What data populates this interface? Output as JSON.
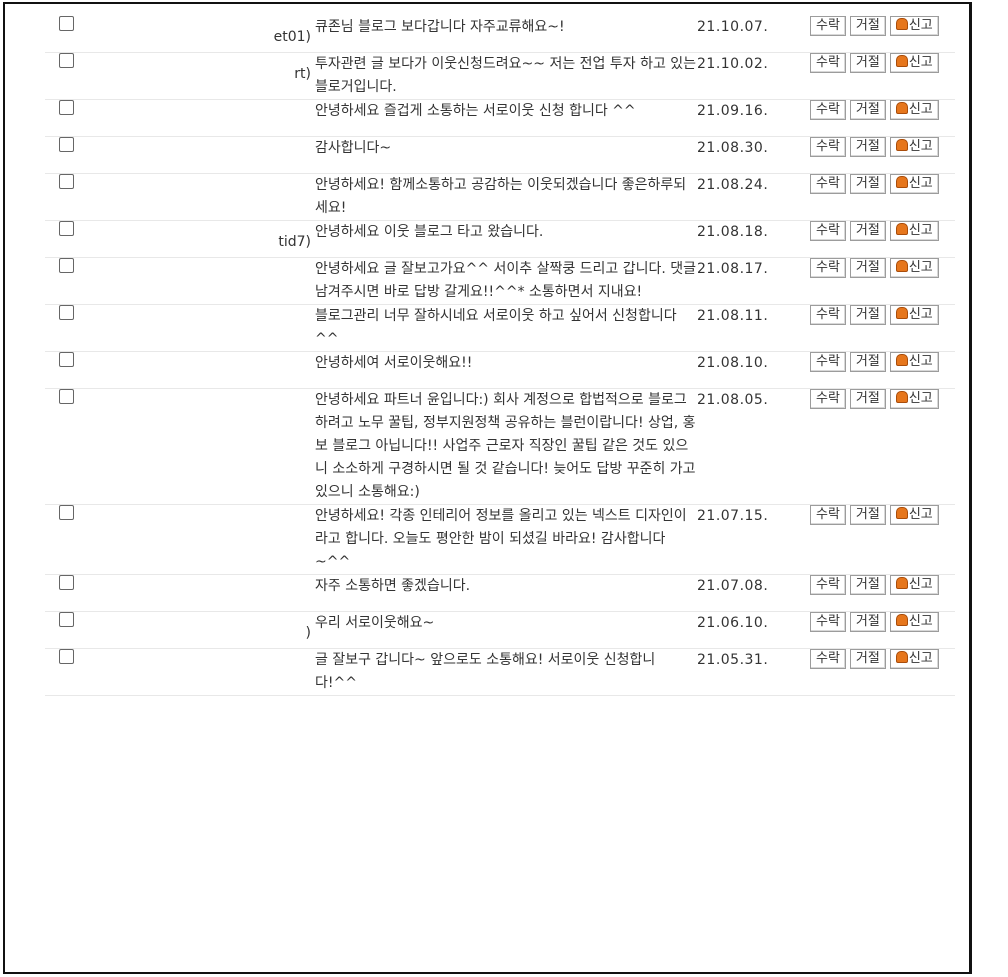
{
  "buttons": {
    "accept": "수락",
    "reject": "거절",
    "report": "신고"
  },
  "requests": [
    {
      "name_lead": "",
      "name_tail": "et01)",
      "message": "큐존님 블로그 보다갑니다 자주교류해요~!",
      "date": "21.10.07."
    },
    {
      "name_lead": "",
      "name_tail": "rt)",
      "message": "투자관련 글 보다가 이웃신청드려요~~ 저는 전업 투자 하고 있는 블로거입니다.",
      "date": "21.10.02."
    },
    {
      "name_lead": "",
      "name_tail": "",
      "message": "안녕하세요 즐겁게 소통하는 서로이웃 신청 합니다 ^^",
      "date": "21.09.16."
    },
    {
      "name_lead": "",
      "name_tail": "",
      "message": "감사합니다~",
      "date": "21.08.30."
    },
    {
      "name_lead": "",
      "name_tail": "",
      "message": "안녕하세요! 함께소통하고 공감하는 이웃되겠습니다 좋은하루되세요!",
      "date": "21.08.24."
    },
    {
      "name_lead": "",
      "name_tail": "tid7)",
      "message": "안녕하세요 이웃 블로그 타고 왔습니다.",
      "date": "21.08.18."
    },
    {
      "name_lead": "",
      "name_tail": "",
      "message": "안녕하세요 글 잘보고가요^^ 서이추 살짝쿵 드리고 갑니다. 댓글 남겨주시면 바로 답방 갈게요!!^^* 소통하면서 지내요!",
      "date": "21.08.17."
    },
    {
      "name_lead": "",
      "name_tail": "",
      "message": "블로그관리 너무 잘하시네요 서로이웃 하고 싶어서 신청합니다^^",
      "date": "21.08.11."
    },
    {
      "name_lead": "",
      "name_tail": "",
      "message": "안녕하세여 서로이웃해요!!",
      "date": "21.08.10."
    },
    {
      "name_lead": "",
      "name_tail": "",
      "message": "안녕하세요 파트너 윤입니다:) 회사 계정으로 합법적으로 블로그 하려고 노무 꿀팁, 정부지원정책 공유하는 블런이랍니다! 상업, 홍보 블로그 아닙니다!! 사업주 근로자 직장인 꿀팁 같은 것도 있으니 소소하게 구경하시면 될 것 같습니다! 늦어도 답방 꾸준히 가고 있으니 소통해요:)",
      "date": "21.08.05."
    },
    {
      "name_lead": "",
      "name_tail": "",
      "message": "안녕하세요! 각종 인테리어 정보를 올리고 있는 넥스트 디자인이라고 합니다. 오늘도 평안한 밤이 되셨길 바라요! 감사합니다~^^",
      "date": "21.07.15."
    },
    {
      "name_lead": "",
      "name_tail": "",
      "message": "자주 소통하면 좋겠습니다.",
      "date": "21.07.08."
    },
    {
      "name_lead": "",
      "name_tail": ")",
      "message": "우리 서로이웃해요~",
      "date": "21.06.10."
    },
    {
      "name_lead": "",
      "name_tail": "",
      "message": "글 잘보구 갑니다~ 앞으로도 소통해요! 서로이웃 신청합니다!^^",
      "date": "21.05.31."
    }
  ]
}
